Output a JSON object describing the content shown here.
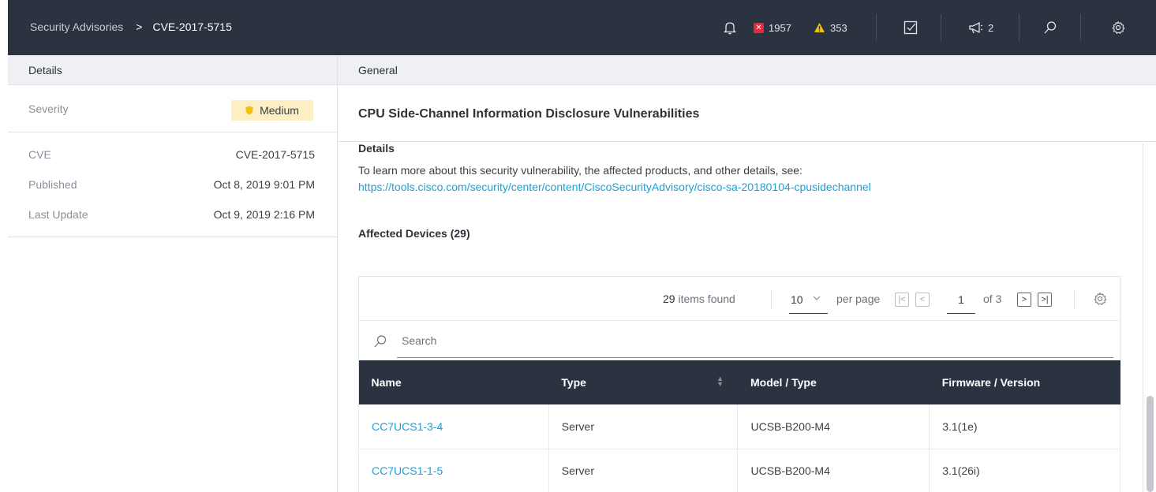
{
  "header": {
    "breadcrumb_root": "Security Advisories",
    "breadcrumb_sep": ">",
    "breadcrumb_current": "CVE-2017-5715",
    "critical_count": "1957",
    "warning_count": "353",
    "announcements_count": "2"
  },
  "left": {
    "header": "Details",
    "severity_label": "Severity",
    "severity_value": "Medium",
    "fields": [
      {
        "key": "CVE",
        "value": "CVE-2017-5715"
      },
      {
        "key": "Published",
        "value": "Oct 8, 2019 9:01 PM"
      },
      {
        "key": "Last Update",
        "value": "Oct 9, 2019 2:16 PM"
      }
    ]
  },
  "right": {
    "header": "General",
    "title": "CPU Side-Channel Information Disclosure Vulnerabilities",
    "details_label": "Details",
    "description": "To learn more about this security vulnerability, the affected products, and other details, see:",
    "link": "https://tools.cisco.com/security/center/content/CiscoSecurityAdvisory/cisco-sa-20180104-cpusidechannel",
    "affected_label": "Affected Devices (29)"
  },
  "table": {
    "items_found_num": "29",
    "items_found_text": "items found",
    "per_page_value": "10",
    "per_page_label": "per page",
    "page": "1",
    "of_pages": "of 3",
    "search_placeholder": "Search",
    "columns": [
      "Name",
      "Type",
      "Model / Type",
      "Firmware / Version"
    ],
    "rows": [
      {
        "name": "CC7UCS1-3-4",
        "type": "Server",
        "model": "UCSB-B200-M4",
        "firmware": "3.1(1e)"
      },
      {
        "name": "CC7UCS1-1-5",
        "type": "Server",
        "model": "UCSB-B200-M4",
        "firmware": "3.1(26i)"
      }
    ]
  },
  "colors": {
    "topbar": "#2b3240",
    "accent_link": "#1ba0d8",
    "critical": "#e6283a",
    "warning": "#f4c20d",
    "severity_bg": "#fcefc4"
  }
}
